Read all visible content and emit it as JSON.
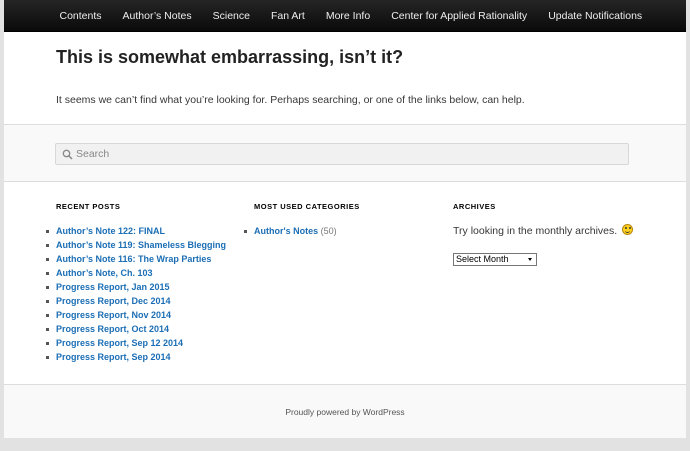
{
  "nav": {
    "items": [
      "Contents",
      "Author’s Notes",
      "Science",
      "Fan Art",
      "More Info",
      "Center for Applied Rationality",
      "Update Notifications"
    ]
  },
  "main": {
    "title": "This is somewhat embarrassing, isn’t it?",
    "intro": "It seems we can’t find what you’re looking for. Perhaps searching, or one of the links below, can help."
  },
  "search": {
    "placeholder": "Search",
    "icon": "search-icon"
  },
  "recent_posts": {
    "heading": "RECENT POSTS",
    "items": [
      "Author’s Note 122: FINAL",
      "Author’s Note 119: Shameless Blegging",
      "Author’s Note 116: The Wrap Parties",
      "Author’s Note, Ch. 103",
      "Progress Report, Jan 2015",
      "Progress Report, Dec 2014",
      "Progress Report, Nov 2014",
      "Progress Report, Oct 2014",
      "Progress Report, Sep 12 2014",
      "Progress Report, Sep 2014"
    ]
  },
  "categories": {
    "heading": "MOST USED CATEGORIES",
    "items": [
      {
        "label": "Author's Notes",
        "count": "(50)"
      }
    ]
  },
  "archives": {
    "heading": "ARCHIVES",
    "text": "Try looking in the monthly archives.",
    "select_value": "Select Month"
  },
  "footer": {
    "text": "Proudly powered by WordPress"
  },
  "colors": {
    "link": "#1b6eb5",
    "nav_bg": "#0a0a0a",
    "page_bg": "#e2e2e2"
  }
}
